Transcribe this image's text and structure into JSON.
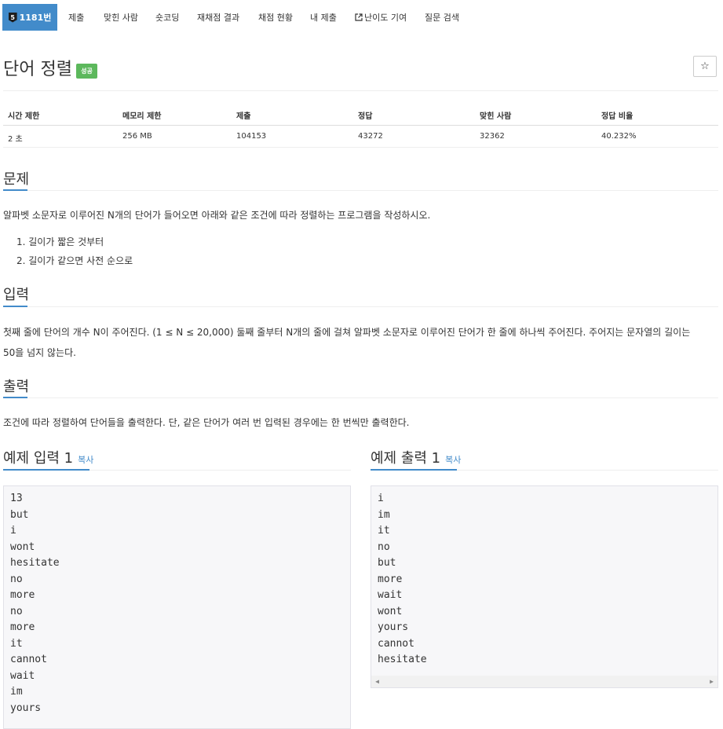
{
  "nav": {
    "tier_icon": "5",
    "active_label": "1181번",
    "items": [
      "제출",
      "맞힌 사람",
      "숏코딩",
      "재채점 결과",
      "채점 현황",
      "내 제출",
      "난이도 기여",
      "질문 검색"
    ],
    "external_icon": "external-link-icon"
  },
  "problem": {
    "title": "단어 정렬",
    "badge": "성공",
    "star": "☆"
  },
  "stats": {
    "headers": [
      "시간 제한",
      "메모리 제한",
      "제출",
      "정답",
      "맞힌 사람",
      "정답 비율"
    ],
    "values": [
      "2 초",
      "256 MB",
      "104153",
      "43272",
      "32362",
      "40.232%"
    ]
  },
  "sections": {
    "problem_head": "문제",
    "problem_text": "알파벳 소문자로 이루어진 N개의 단어가 들어오면 아래와 같은 조건에 따라 정렬하는 프로그램을 작성하시오.",
    "conditions": [
      "길이가 짧은 것부터",
      "길이가 같으면 사전 순으로"
    ],
    "input_head": "입력",
    "input_text_1": "첫째 줄에 단어의 개수 N이 주어진다. (1 ≤ N ≤ 20,000) 둘째 줄부터 N개의 줄에 걸쳐 알파벳 소문자로 이루어진 단어가 한 줄에 하나씩 주어진다. 주어지는 문자열의 길이는",
    "input_text_2": "50을 넘지 않는다.",
    "output_head": "출력",
    "output_text": "조건에 따라 정렬하여 단어들을 출력한다. 단, 같은 단어가 여러 번 입력된 경우에는 한 번씩만 출력한다."
  },
  "sample": {
    "input_head": "예제 입력 1",
    "output_head": "예제 출력 1",
    "copy_label": "복사",
    "input_lines": [
      "13",
      "but",
      "i",
      "wont",
      "hesitate",
      "no",
      "more",
      "no",
      "more",
      "it",
      "cannot",
      "wait",
      "im",
      "yours"
    ],
    "output_lines": [
      "i",
      "im",
      "it",
      "no",
      "but",
      "more",
      "wait",
      "wont",
      "yours",
      "cannot",
      "hesitate"
    ]
  },
  "colors": {
    "accent": "#428bca",
    "success": "#5cb85c",
    "code_bg": "#f7f7f9"
  }
}
